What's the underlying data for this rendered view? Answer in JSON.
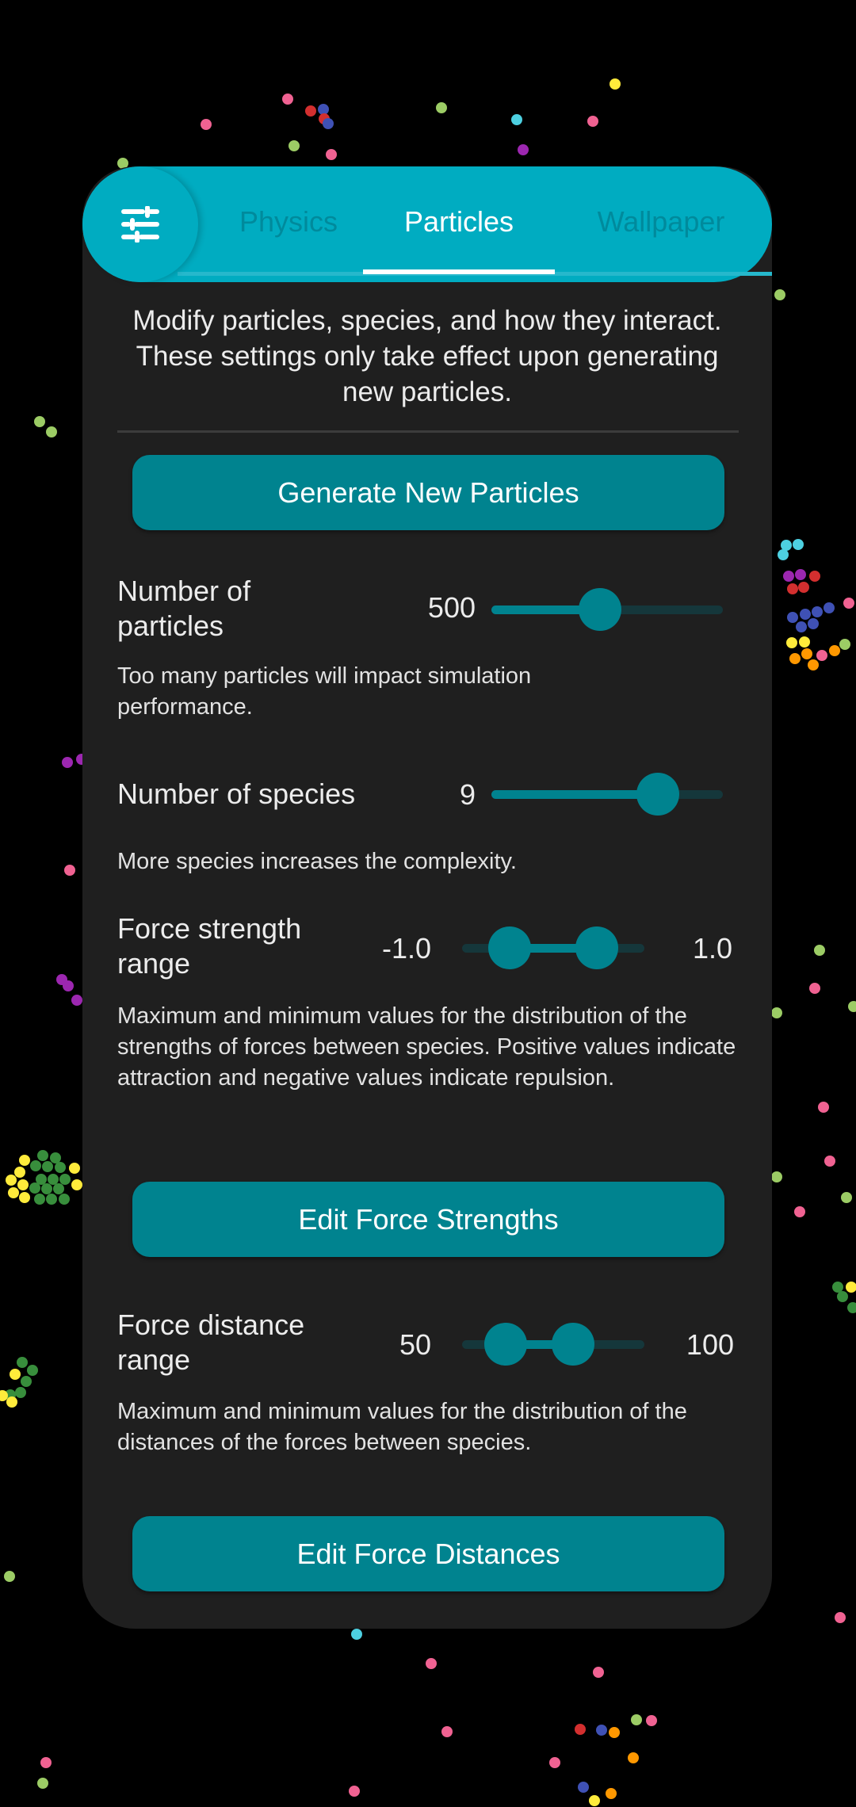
{
  "tabs": [
    {
      "label": "Physics",
      "active": false
    },
    {
      "label": "Particles",
      "active": true
    },
    {
      "label": "Wallpaper",
      "active": false
    }
  ],
  "menu_icon": "tune-sliders-icon",
  "intro_text": "Modify particles, species, and how they interact. These settings only take effect upon generating new particles.",
  "generate_button": "Generate New Particles",
  "num_particles": {
    "label": "Number of particles",
    "value": "500",
    "fraction": 0.47,
    "help": "Too many particles will impact simulation performance."
  },
  "num_species": {
    "label": "Number of species",
    "value": "9",
    "fraction": 0.72,
    "help": "More species increases the complexity."
  },
  "force_strength": {
    "label": "Force strength range",
    "min_value": "-1.0",
    "max_value": "1.0",
    "low_fraction": 0.26,
    "high_fraction": 0.74,
    "help": "Maximum and minimum values for the distribution of the strengths of forces between species. Positive values indicate attraction and negative values indicate repulsion."
  },
  "edit_strengths_button": "Edit Force Strengths",
  "force_distance": {
    "label": "Force distance range",
    "min_value": "50",
    "max_value": "100",
    "low_fraction": 0.24,
    "high_fraction": 0.61,
    "help": "Maximum and minimum values for the distribution of the distances of the forces between species."
  },
  "edit_distances_button": "Edit Force Distances",
  "colors": {
    "accent": "#00acc1",
    "button": "#00838f",
    "panel": "#1f1f1f",
    "background": "#000000"
  },
  "particle_colors": {
    "pink": "#f06292",
    "green": "#9ccc65",
    "darkgreen": "#388e3c",
    "red": "#d32f2f",
    "blue": "#3f51b5",
    "cyan": "#4dd0e1",
    "purple": "#9c27b0",
    "yellow": "#ffeb3b",
    "orange": "#ff9800"
  }
}
